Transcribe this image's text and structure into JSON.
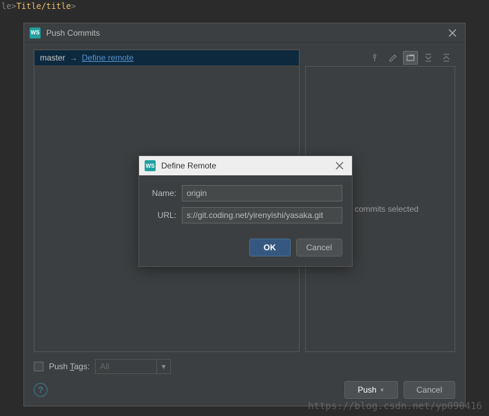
{
  "background_code": {
    "prefix": "le>",
    "tag_open": "Title",
    "content": "",
    "tag_close": "/title",
    "suffix": ">"
  },
  "push_dialog": {
    "title": "Push Commits",
    "branch": "master",
    "arrow": "→",
    "define_remote_link": "Define remote",
    "right_panel": {
      "empty_text": "No commits selected"
    },
    "footer": {
      "push_tags_label": "Push Tags:",
      "push_tags_combo": "All",
      "help": "?",
      "push_button": "Push",
      "cancel_button": "Cancel"
    }
  },
  "define_remote_dialog": {
    "title": "Define Remote",
    "name_label": "Name:",
    "name_value": "origin",
    "url_label": "URL:",
    "url_value": "s://git.coding.net/yirenyishi/yasaka.git",
    "ok_button": "OK",
    "cancel_button": "Cancel"
  },
  "watermark": "https://blog.csdn.net/yp090416"
}
